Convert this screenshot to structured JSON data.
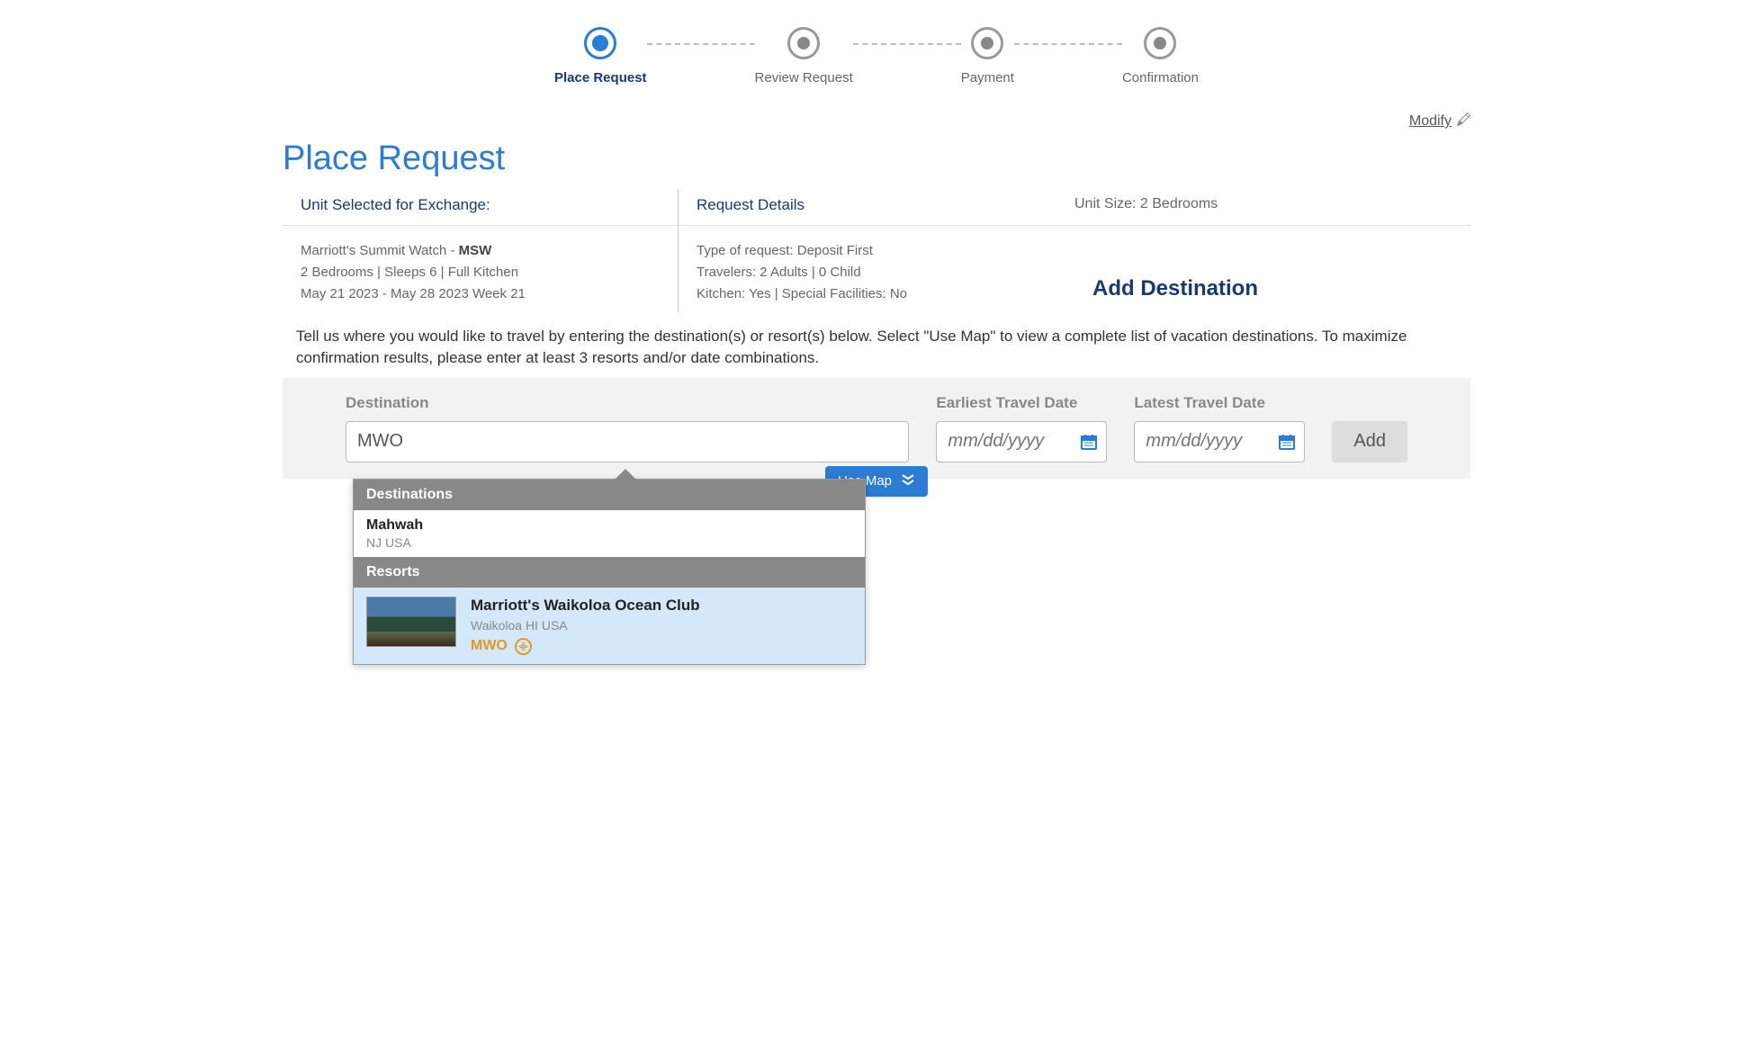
{
  "stepper": {
    "steps": [
      {
        "label": "Place Request",
        "active": true
      },
      {
        "label": "Review Request",
        "active": false
      },
      {
        "label": "Payment",
        "active": false
      },
      {
        "label": "Confirmation",
        "active": false
      }
    ]
  },
  "modify_link": "Modify",
  "page_title": "Place Request",
  "unit_selected": {
    "heading": "Unit Selected for Exchange:",
    "resort_name": "Marriott's Summit Watch - ",
    "resort_code": "MSW",
    "size_line": "2 Bedrooms | Sleeps 6 | Full Kitchen",
    "dates_line": "May 21 2023 - May 28 2023 Week 21"
  },
  "request_details": {
    "heading": "Request Details",
    "type_line": "Type of request: Deposit First",
    "travelers_line": "Travelers: 2 Adults  |  0 Child",
    "kitchen_line": "Kitchen: Yes  |  Special Facilities: No"
  },
  "unit_size_label": "Unit Size: 2 Bedrooms",
  "add_destination_title": "Add Destination",
  "instructions": "Tell us where you would like to travel by entering the destination(s) or resort(s) below. Select \"Use Map\" to view a complete list of vacation destinations. To maximize confirmation results, please enter at least 3 resorts and/or date combinations.",
  "search": {
    "destination_label": "Destination",
    "destination_value": "MWO",
    "earliest_label": "Earliest Travel Date",
    "earliest_placeholder": "mm/dd/yyyy",
    "latest_label": "Latest Travel Date",
    "latest_placeholder": "mm/dd/yyyy",
    "add_button": "Add",
    "use_map_button": "Use Map"
  },
  "autocomplete": {
    "destinations_header": "Destinations",
    "resorts_header": "Resorts",
    "destinations": [
      {
        "name": "Mahwah",
        "sub": "NJ USA"
      }
    ],
    "resorts": [
      {
        "name": "Marriott's Waikoloa Ocean Club",
        "location": "Waikoloa HI USA",
        "code": "MWO"
      }
    ]
  }
}
